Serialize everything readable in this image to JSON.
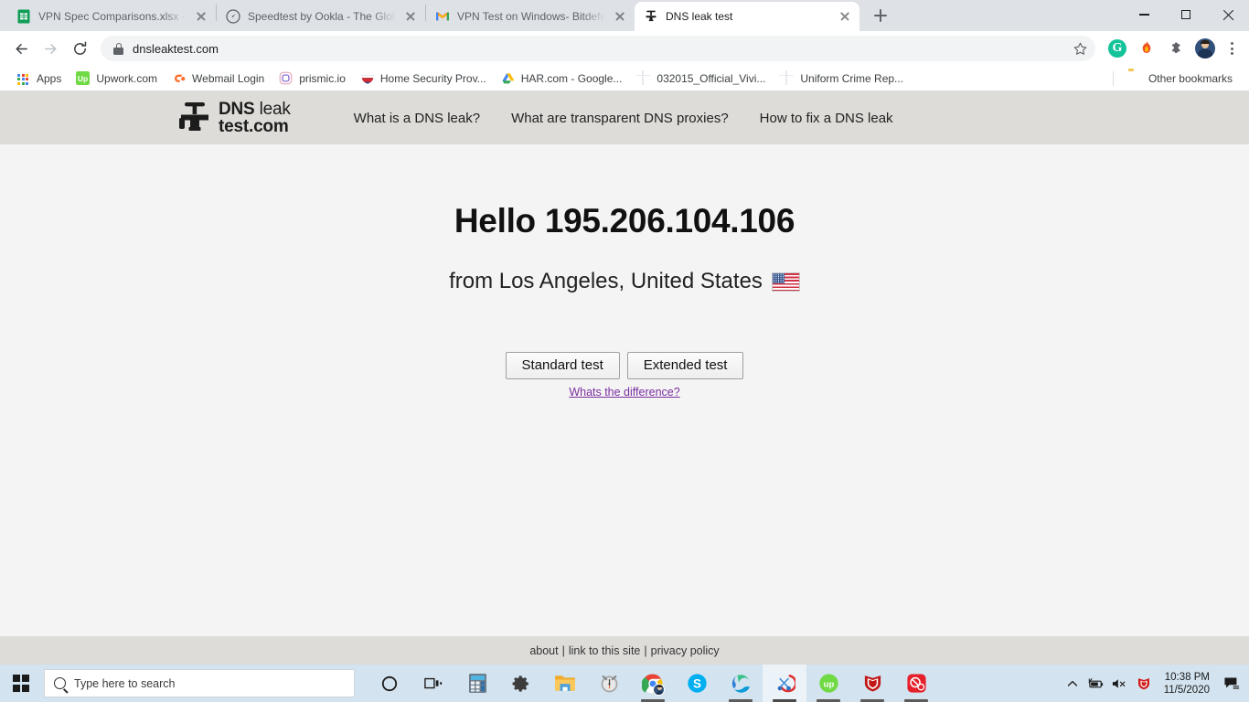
{
  "browser": {
    "tabs": [
      {
        "title": "VPN Spec Comparisons.xlsx - Goo",
        "favicon": "google-sheets-icon",
        "active": false
      },
      {
        "title": "Speedtest by Ookla - The Global B",
        "favicon": "speedtest-icon",
        "active": false
      },
      {
        "title": "VPN Test on Windows- Bitdefend",
        "favicon": "gmail-icon",
        "active": false
      },
      {
        "title": "DNS leak test",
        "favicon": "faucet-icon",
        "active": true
      }
    ],
    "new_tab_label": "+",
    "window_controls": {
      "minimize": "minimize",
      "maximize": "maximize",
      "close": "close"
    },
    "omnibox": {
      "url": "dnsleaktest.com",
      "lock_icon": "lock-icon",
      "star_icon": "star-icon"
    },
    "toolbar_icons": [
      "grammarly-icon",
      "flame-icon",
      "extensions-puzzle-icon",
      "profile-avatar",
      "chrome-menu-icon"
    ],
    "grammarly_letter": "G",
    "bookmarks": [
      {
        "label": "Apps",
        "icon": "apps-grid-icon"
      },
      {
        "label": "Upwork.com",
        "icon": "upwork-icon"
      },
      {
        "label": "Webmail Login",
        "icon": "cpanel-icon"
      },
      {
        "label": "prismic.io",
        "icon": "prismic-icon"
      },
      {
        "label": "Home Security Prov...",
        "icon": "shield-icon"
      },
      {
        "label": "HAR.com - Google...",
        "icon": "google-drive-icon"
      },
      {
        "label": "032015_Official_Vivi...",
        "icon": "globe-icon"
      },
      {
        "label": "Uniform Crime Rep...",
        "icon": "globe-icon"
      }
    ],
    "other_bookmarks": {
      "label": "Other bookmarks",
      "icon": "folder-icon"
    }
  },
  "site": {
    "logo": {
      "bold1": "DNS",
      "light1": "leak",
      "bold2": "test.com",
      "icon": "faucet-icon"
    },
    "nav": [
      {
        "label": "What is a DNS leak?"
      },
      {
        "label": "What are transparent DNS proxies?"
      },
      {
        "label": "How to fix a DNS leak"
      }
    ],
    "hero": {
      "greeting": "Hello 195.206.104.106",
      "ip": "195.206.104.106",
      "location": "from Los Angeles, United States",
      "flag": "us-flag-icon"
    },
    "buttons": {
      "standard": "Standard test",
      "extended": "Extended test",
      "difference_link": "Whats the difference?"
    },
    "footer": {
      "about": "about",
      "link_to_site": "link to this site",
      "privacy": "privacy policy",
      "separator": "|"
    },
    "colors": {
      "header_bg": "#dddcd8",
      "page_bg": "#f4f4f4",
      "link_purple": "#7b2fa0"
    }
  },
  "taskbar": {
    "start": "windows-start-icon",
    "search_placeholder": "Type here to search",
    "search_icon": "search-icon",
    "items": [
      {
        "name": "cortana-icon",
        "running": false
      },
      {
        "name": "task-view-icon",
        "running": false
      },
      {
        "name": "calculator-icon",
        "running": false
      },
      {
        "name": "settings-gear-icon",
        "running": false
      },
      {
        "name": "file-explorer-icon",
        "running": false
      },
      {
        "name": "alarms-clock-icon",
        "running": false
      },
      {
        "name": "google-chrome-icon",
        "running": true
      },
      {
        "name": "skype-icon",
        "running": false
      },
      {
        "name": "microsoft-edge-icon",
        "running": true
      },
      {
        "name": "snip-and-sketch-icon",
        "running": true,
        "active": true
      },
      {
        "name": "upwork-icon",
        "running": true
      },
      {
        "name": "mcafee-icon",
        "running": true
      },
      {
        "name": "red-app-icon",
        "running": true
      }
    ],
    "tray": {
      "chevron": "show-hidden-icons-chevron",
      "battery": "battery-icon",
      "volume": "volume-muted-icon",
      "mcafee": "mcafee-tray-icon",
      "time": "10:38 PM",
      "date": "11/5/2020",
      "action_center": "action-center-icon"
    }
  }
}
